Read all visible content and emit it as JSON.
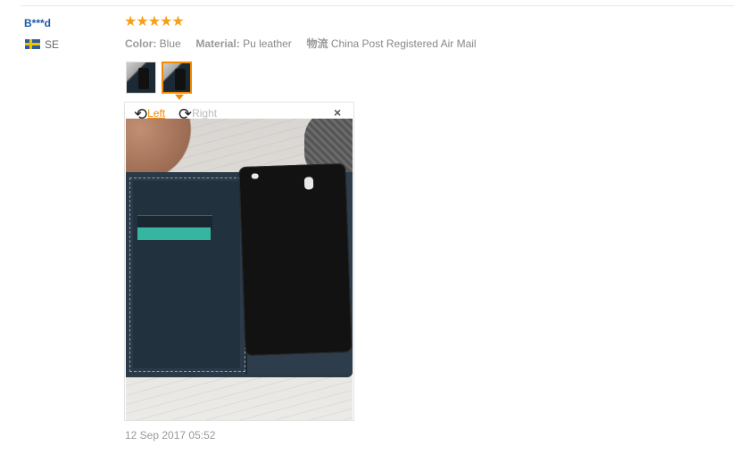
{
  "review": {
    "user": "B***d",
    "country_code": "SE",
    "rating_stars": "★★★★★",
    "rating": 5,
    "attributes": {
      "color_label": "Color:",
      "color_value": "Blue",
      "material_label": "Material:",
      "material_value": "Pu leather",
      "shipping_label": "物流",
      "shipping_value": "China Post Registered Air Mail"
    },
    "viewer": {
      "rotate_left_label": "Left",
      "rotate_right_label": "Right",
      "close_glyph": "×",
      "rotate_left_glyph": "⟲",
      "rotate_right_glyph": "⟳"
    },
    "date": "12 Sep 2017 05:52"
  },
  "colors": {
    "user_name": "#1a58a8",
    "stars": "#f5a01a",
    "active_accent": "#f28a00"
  },
  "icons": {
    "flag": "sweden-flag-icon",
    "rotate_left": "rotate-left-icon",
    "rotate_right": "rotate-right-icon",
    "close": "close-icon"
  }
}
